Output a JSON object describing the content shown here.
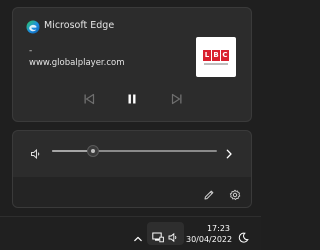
{
  "media": {
    "app_name": "Microsoft Edge",
    "app_icon": "edge-icon",
    "title": "-",
    "subtitle": "www.globalplayer.com",
    "artwork": {
      "logo_text": [
        "L",
        "B",
        "C"
      ],
      "logo_color": "#d9202f"
    },
    "controls": [
      "previous-icon",
      "pause-icon",
      "next-icon"
    ]
  },
  "volume": {
    "icon": "speaker-icon",
    "level_percent": 25
  },
  "quick_settings": {
    "edit_icon": "pencil-icon",
    "settings_icon": "gear-icon"
  },
  "taskbar": {
    "time": "17:23",
    "date": "30/04/2022",
    "tray_icons": [
      "chevron-up-icon",
      "network-icon",
      "volume-icon",
      "notification-moon-icon"
    ]
  },
  "colors": {
    "card_bg": "#2c2c2c",
    "page_bg": "#1f1f1f",
    "edge_blue": "#1a8ee3",
    "edge_green": "#2fc75f"
  }
}
